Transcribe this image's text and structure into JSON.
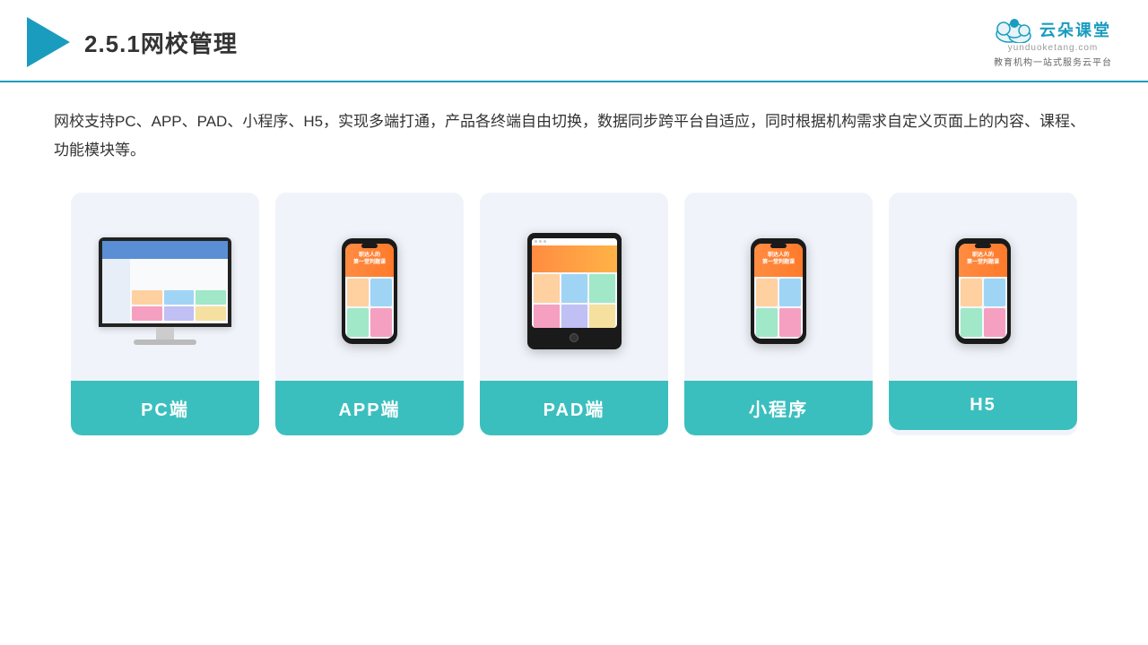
{
  "header": {
    "title": "2.5.1网校管理",
    "brand_name": "云朵课堂",
    "brand_url": "yunduoketang.com",
    "brand_tagline": "教育机构一站式服务云平台"
  },
  "description": "网校支持PC、APP、PAD、小程序、H5，实现多端打通，产品各终端自由切换，数据同步跨平台自适应，同时根据机构需求自定义页面上的内容、课程、功能模块等。",
  "devices": [
    {
      "id": "pc",
      "label": "PC端",
      "type": "desktop"
    },
    {
      "id": "app",
      "label": "APP端",
      "type": "phone"
    },
    {
      "id": "pad",
      "label": "PAD端",
      "type": "tablet"
    },
    {
      "id": "miniprogram",
      "label": "小程序",
      "type": "phone"
    },
    {
      "id": "h5",
      "label": "H5",
      "type": "phone"
    }
  ]
}
